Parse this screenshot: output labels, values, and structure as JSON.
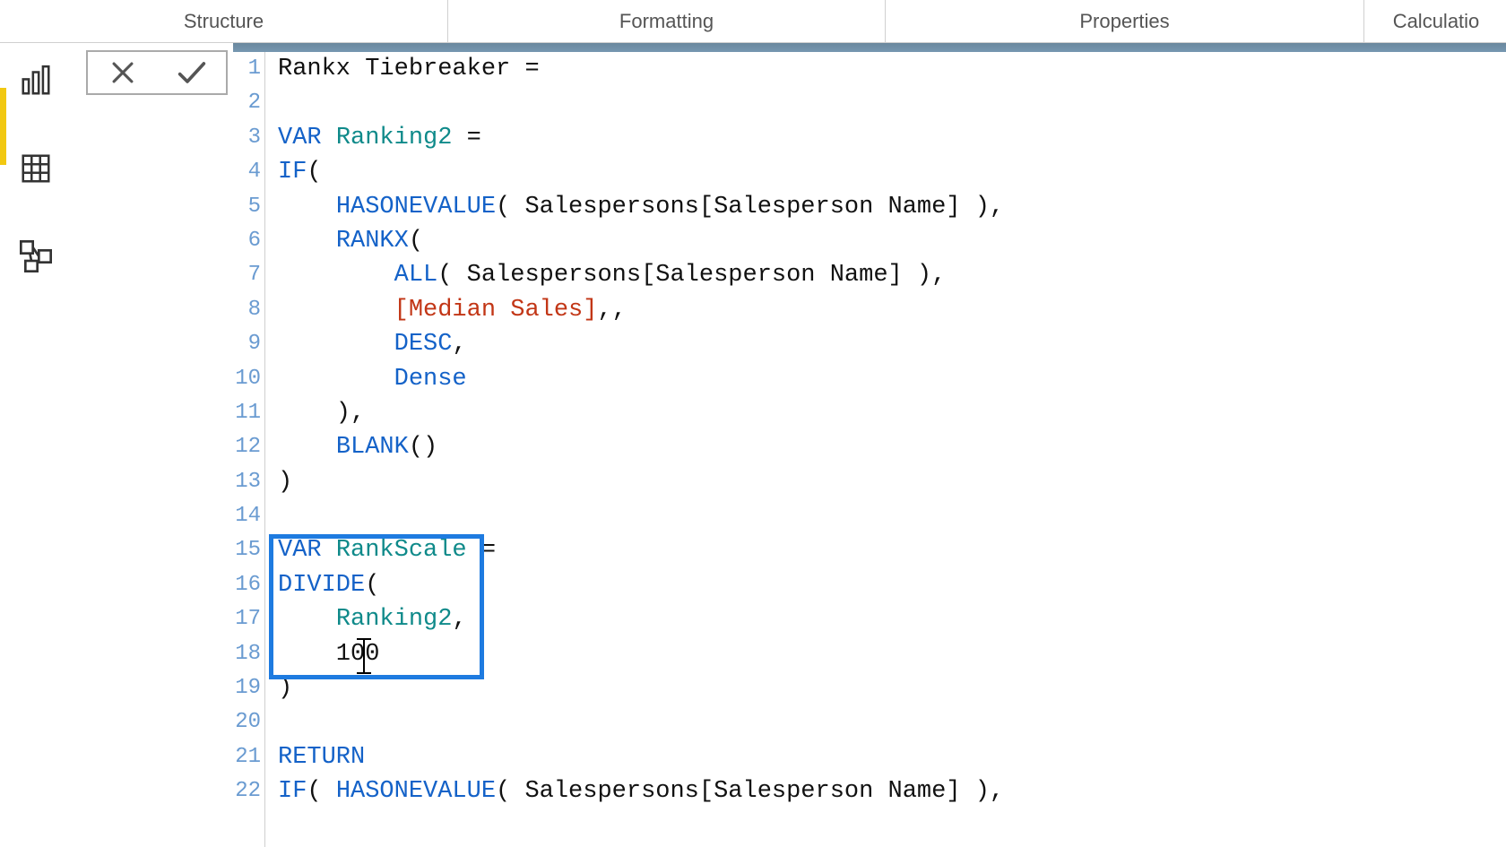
{
  "tabs": {
    "structure": "Structure",
    "formatting": "Formatting",
    "properties": "Properties",
    "calculation": "Calculatio"
  },
  "icons": {
    "cancel": "✕",
    "commit": "✓"
  },
  "code": {
    "lines": [
      {
        "num": "1",
        "tokens": [
          {
            "t": "Rankx Tiebreaker = ",
            "c": "tok-id"
          }
        ]
      },
      {
        "num": "2",
        "tokens": [
          {
            "t": "",
            "c": ""
          }
        ]
      },
      {
        "num": "3",
        "tokens": [
          {
            "t": "VAR",
            "c": "tok-kw"
          },
          {
            "t": " ",
            "c": ""
          },
          {
            "t": "Ranking2",
            "c": "tok-var"
          },
          {
            "t": " =",
            "c": "tok-id"
          }
        ]
      },
      {
        "num": "4",
        "tokens": [
          {
            "t": "IF",
            "c": "tok-fn"
          },
          {
            "t": "(",
            "c": "tok-punc"
          }
        ]
      },
      {
        "num": "5",
        "tokens": [
          {
            "t": "    ",
            "c": ""
          },
          {
            "t": "HASONEVALUE",
            "c": "tok-fn"
          },
          {
            "t": "( Salespersons[Salesperson Name] ),",
            "c": "tok-id"
          }
        ]
      },
      {
        "num": "6",
        "tokens": [
          {
            "t": "    ",
            "c": ""
          },
          {
            "t": "RANKX",
            "c": "tok-fn"
          },
          {
            "t": "(",
            "c": "tok-punc"
          }
        ]
      },
      {
        "num": "7",
        "tokens": [
          {
            "t": "        ",
            "c": ""
          },
          {
            "t": "ALL",
            "c": "tok-fn"
          },
          {
            "t": "( Salespersons[Salesperson Name] ),",
            "c": "tok-id"
          }
        ]
      },
      {
        "num": "8",
        "tokens": [
          {
            "t": "        ",
            "c": ""
          },
          {
            "t": "[Median Sales]",
            "c": "tok-ref"
          },
          {
            "t": ",,",
            "c": "tok-punc"
          }
        ]
      },
      {
        "num": "9",
        "tokens": [
          {
            "t": "        ",
            "c": ""
          },
          {
            "t": "DESC",
            "c": "tok-fn"
          },
          {
            "t": ",",
            "c": "tok-punc"
          }
        ]
      },
      {
        "num": "10",
        "tokens": [
          {
            "t": "        ",
            "c": ""
          },
          {
            "t": "Dense",
            "c": "tok-fn"
          }
        ]
      },
      {
        "num": "11",
        "tokens": [
          {
            "t": "    ),",
            "c": "tok-punc"
          }
        ]
      },
      {
        "num": "12",
        "tokens": [
          {
            "t": "    ",
            "c": ""
          },
          {
            "t": "BLANK",
            "c": "tok-fn"
          },
          {
            "t": "()",
            "c": "tok-punc"
          }
        ]
      },
      {
        "num": "13",
        "tokens": [
          {
            "t": ")",
            "c": "tok-punc"
          }
        ]
      },
      {
        "num": "14",
        "tokens": [
          {
            "t": "",
            "c": ""
          }
        ]
      },
      {
        "num": "15",
        "tokens": [
          {
            "t": "VAR",
            "c": "tok-kw"
          },
          {
            "t": " ",
            "c": ""
          },
          {
            "t": "RankScale",
            "c": "tok-var"
          },
          {
            "t": " =",
            "c": "tok-id"
          }
        ]
      },
      {
        "num": "16",
        "tokens": [
          {
            "t": "DIVIDE",
            "c": "tok-fn"
          },
          {
            "t": "(",
            "c": "tok-punc"
          }
        ]
      },
      {
        "num": "17",
        "tokens": [
          {
            "t": "    ",
            "c": ""
          },
          {
            "t": "Ranking2",
            "c": "tok-var"
          },
          {
            "t": ",",
            "c": "tok-punc"
          }
        ]
      },
      {
        "num": "18",
        "tokens": [
          {
            "t": "    100",
            "c": "tok-id"
          }
        ]
      },
      {
        "num": "19",
        "tokens": [
          {
            "t": ")",
            "c": "tok-punc"
          }
        ]
      },
      {
        "num": "20",
        "tokens": [
          {
            "t": "",
            "c": ""
          }
        ]
      },
      {
        "num": "21",
        "tokens": [
          {
            "t": "RETURN",
            "c": "tok-kw"
          }
        ]
      },
      {
        "num": "22",
        "tokens": [
          {
            "t": "IF",
            "c": "tok-fn"
          },
          {
            "t": "( ",
            "c": "tok-punc"
          },
          {
            "t": "HASONEVALUE",
            "c": "tok-fn"
          },
          {
            "t": "( Salespersons[Salesperson Name] ),",
            "c": "tok-id"
          }
        ]
      }
    ]
  }
}
